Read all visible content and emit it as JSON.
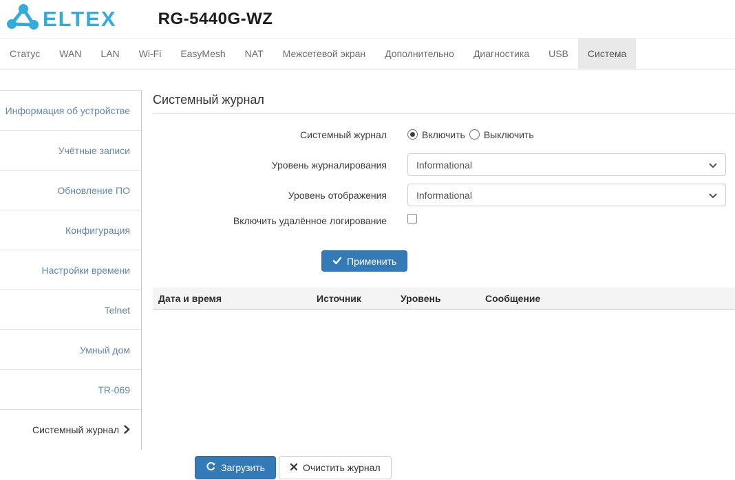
{
  "header": {
    "logo_text": "ELTEX",
    "model": "RG-5440G-WZ"
  },
  "nav": {
    "tabs": [
      {
        "label": "Статус"
      },
      {
        "label": "WAN"
      },
      {
        "label": "LAN"
      },
      {
        "label": "Wi-Fi"
      },
      {
        "label": "EasyMesh"
      },
      {
        "label": "NAT"
      },
      {
        "label": "Межсетевой экран"
      },
      {
        "label": "Дополнительно"
      },
      {
        "label": "Диагностика"
      },
      {
        "label": "USB"
      },
      {
        "label": "Система"
      }
    ],
    "active_tab": "Система"
  },
  "sidebar": {
    "items": [
      {
        "label": "Информация об устройстве"
      },
      {
        "label": "Учётные записи"
      },
      {
        "label": "Обновление ПО"
      },
      {
        "label": "Конфигурация"
      },
      {
        "label": "Настройки времени"
      },
      {
        "label": "Telnet"
      },
      {
        "label": "Умный дом"
      },
      {
        "label": "TR-069"
      },
      {
        "label": "Системный журнал",
        "active": true
      }
    ]
  },
  "main": {
    "title": "Системный журнал",
    "form": {
      "syslog_label": "Системный журнал",
      "radio_on": "Включить",
      "radio_off": "Выключить",
      "radio_selected": "Включить",
      "logging_level_label": "Уровень журналирования",
      "logging_level_value": "Informational",
      "display_level_label": "Уровень отображения",
      "display_level_value": "Informational",
      "remote_logging_label": "Включить удалённое логирование",
      "remote_logging_checked": false,
      "apply_label": "Применить"
    },
    "table": {
      "columns": [
        "Дата и время",
        "Источник",
        "Уровень",
        "Сообщение"
      ],
      "rows": []
    },
    "footer_buttons": {
      "load_label": "Загрузить",
      "clear_label": "Очистить журнал"
    }
  },
  "colors": {
    "accent_blue": "#337ab7",
    "logo_blue": "#35aadc",
    "sidebar_link": "#5f88ad",
    "active_tab_bg": "#e9e9e9",
    "table_header_bg": "#f4f4f4"
  }
}
